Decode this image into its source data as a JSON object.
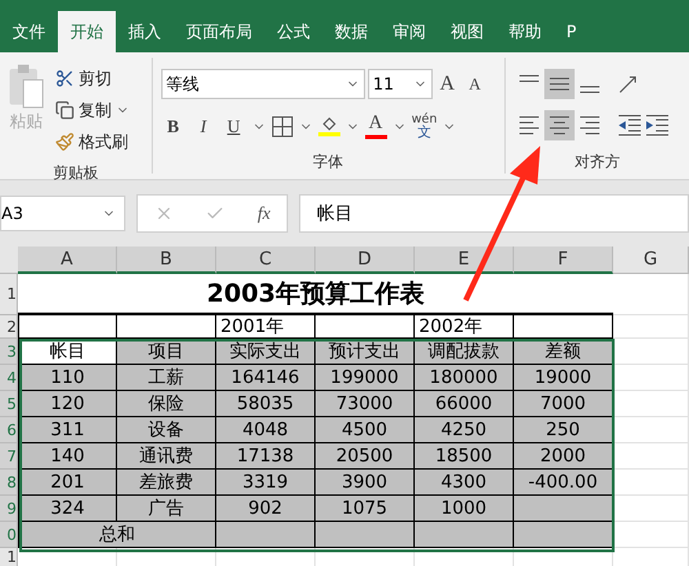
{
  "tabs": [
    {
      "label": "文件",
      "selected": false
    },
    {
      "label": "开始",
      "selected": true
    },
    {
      "label": "插入",
      "selected": false
    },
    {
      "label": "页面布局",
      "selected": false
    },
    {
      "label": "公式",
      "selected": false
    },
    {
      "label": "数据",
      "selected": false
    },
    {
      "label": "审阅",
      "selected": false
    },
    {
      "label": "视图",
      "selected": false
    },
    {
      "label": "帮助",
      "selected": false
    },
    {
      "label": "P",
      "selected": false
    }
  ],
  "clipboard": {
    "paste": {
      "label": "粘贴",
      "disabled": true
    },
    "cut": "剪切",
    "copy": "复制",
    "format_painter": "格式刷",
    "group_label": "剪贴板"
  },
  "font": {
    "name": "等线",
    "size": "11",
    "grow": "A",
    "shrink": "A",
    "bold": "B",
    "italic": "I",
    "underline": "U",
    "font_color_label": "A",
    "phonetic_top": "wén",
    "phonetic_bottom": "文",
    "group_label": "字体"
  },
  "alignment": {
    "vertical": [
      {
        "kind": "top",
        "selected": false
      },
      {
        "kind": "middle",
        "selected": true
      },
      {
        "kind": "bottom",
        "selected": false
      }
    ],
    "horizontal": [
      {
        "kind": "left",
        "selected": false
      },
      {
        "kind": "center",
        "selected": true
      },
      {
        "kind": "right",
        "selected": false
      }
    ],
    "group_label": "对齐方"
  },
  "formula_bar": {
    "name_box": "A3",
    "fx": "fx",
    "value": "帐目"
  },
  "sheet": {
    "columns": [
      {
        "label": "A",
        "selected": true
      },
      {
        "label": "B",
        "selected": true
      },
      {
        "label": "C",
        "selected": true
      },
      {
        "label": "D",
        "selected": true
      },
      {
        "label": "E",
        "selected": true
      },
      {
        "label": "F",
        "selected": true
      },
      {
        "label": "G",
        "selected": false
      }
    ],
    "title": "2003年预算工作表",
    "rows": [
      {
        "header": "1",
        "selected": false,
        "kind": "title",
        "cells": []
      },
      {
        "header": "2",
        "selected": false,
        "kind": "plain",
        "cells": [
          {
            "text": ""
          },
          {
            "text": ""
          },
          {
            "text": "2001年"
          },
          {
            "text": ""
          },
          {
            "text": "2002年"
          },
          {
            "text": ""
          }
        ]
      },
      {
        "header": "3",
        "selected": true,
        "kind": "data",
        "cells": [
          {
            "text": "帐目",
            "active": true
          },
          {
            "text": "项目"
          },
          {
            "text": "实际支出"
          },
          {
            "text": "预计支出"
          },
          {
            "text": "调配拔款"
          },
          {
            "text": "差额"
          }
        ]
      },
      {
        "header": "4",
        "selected": true,
        "kind": "data",
        "cells": [
          {
            "text": "110"
          },
          {
            "text": "工薪"
          },
          {
            "text": "164146"
          },
          {
            "text": "199000"
          },
          {
            "text": "180000"
          },
          {
            "text": "19000"
          }
        ]
      },
      {
        "header": "5",
        "selected": true,
        "kind": "data",
        "cells": [
          {
            "text": "120"
          },
          {
            "text": "保险"
          },
          {
            "text": "58035"
          },
          {
            "text": "73000"
          },
          {
            "text": "66000"
          },
          {
            "text": "7000"
          }
        ]
      },
      {
        "header": "6",
        "selected": true,
        "kind": "data",
        "cells": [
          {
            "text": "311"
          },
          {
            "text": "设备"
          },
          {
            "text": "4048"
          },
          {
            "text": "4500"
          },
          {
            "text": "4250"
          },
          {
            "text": "250"
          }
        ]
      },
      {
        "header": "7",
        "selected": true,
        "kind": "data",
        "cells": [
          {
            "text": "140"
          },
          {
            "text": "通讯费"
          },
          {
            "text": "17138"
          },
          {
            "text": "20500"
          },
          {
            "text": "18500"
          },
          {
            "text": "2000"
          }
        ]
      },
      {
        "header": "8",
        "selected": true,
        "kind": "data",
        "cells": [
          {
            "text": "201"
          },
          {
            "text": "差旅费"
          },
          {
            "text": "3319"
          },
          {
            "text": "3900"
          },
          {
            "text": "4300"
          },
          {
            "text": "-400.00"
          }
        ]
      },
      {
        "header": "9",
        "selected": true,
        "kind": "data",
        "cells": [
          {
            "text": "324"
          },
          {
            "text": "广告"
          },
          {
            "text": "902"
          },
          {
            "text": "1075"
          },
          {
            "text": "1000"
          },
          {
            "text": ""
          }
        ]
      },
      {
        "header": "0",
        "selected": true,
        "kind": "total",
        "cells": [
          {
            "text": "总和"
          },
          {
            "text": ""
          },
          {
            "text": ""
          },
          {
            "text": ""
          },
          {
            "text": ""
          },
          {
            "text": ""
          }
        ]
      },
      {
        "header": "1",
        "selected": false,
        "kind": "empty",
        "cells": []
      }
    ]
  }
}
